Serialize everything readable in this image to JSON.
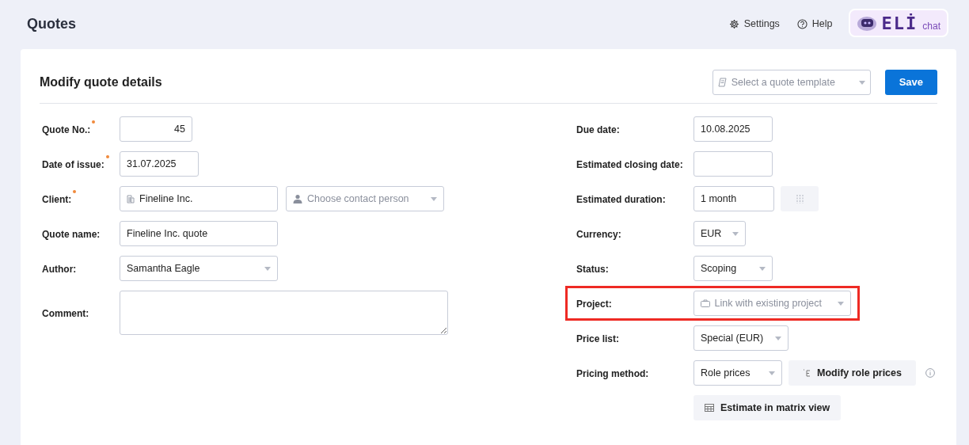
{
  "page": {
    "title": "Quotes"
  },
  "header_links": [
    {
      "kind": "settings",
      "label": "Settings"
    },
    {
      "kind": "help",
      "label": "Help"
    }
  ],
  "chat_badge": {
    "logo": "ELİ",
    "label": "chat"
  },
  "card": {
    "title": "Modify quote details",
    "template_select": {
      "placeholder": "Select a quote template"
    },
    "save_button": "Save"
  },
  "left_fields": [
    {
      "kind": "number",
      "label": "Quote No.:",
      "required": true,
      "value": "45"
    },
    {
      "kind": "text",
      "label": "Date of issue:",
      "required": true,
      "value": "31.07.2025"
    },
    {
      "kind": "client",
      "label": "Client:",
      "required": true,
      "value": "Fineline Inc.",
      "contact_placeholder": "Choose contact person"
    },
    {
      "kind": "text",
      "label": "Quote name:",
      "required": false,
      "value": "Fineline Inc. quote"
    },
    {
      "kind": "select",
      "label": "Author:",
      "required": false,
      "value": "Samantha Eagle"
    },
    {
      "kind": "textarea",
      "label": "Comment:",
      "required": false
    }
  ],
  "right_fields": [
    {
      "kind": "text",
      "label": "Due date:",
      "value": "10.08.2025",
      "highlighted": false
    },
    {
      "kind": "text",
      "label": "Estimated closing date:",
      "highlighted": false
    },
    {
      "kind": "duration",
      "label": "Estimated duration:",
      "value": "1 month",
      "highlighted": false
    },
    {
      "kind": "select",
      "label": "Currency:",
      "value": "EUR",
      "highlighted": false
    },
    {
      "kind": "select",
      "label": "Status:",
      "value": "Scoping",
      "highlighted": false
    },
    {
      "kind": "project",
      "label": "Project:",
      "placeholder": "Link with existing project",
      "highlighted": true
    },
    {
      "kind": "select",
      "label": "Price list:",
      "value": "Special (EUR)",
      "highlighted": false
    },
    {
      "kind": "pricing",
      "label": "Pricing method:",
      "value": "Role prices",
      "button": "Modify role prices",
      "highlighted": false
    }
  ],
  "matrix_button": "Estimate in matrix view"
}
